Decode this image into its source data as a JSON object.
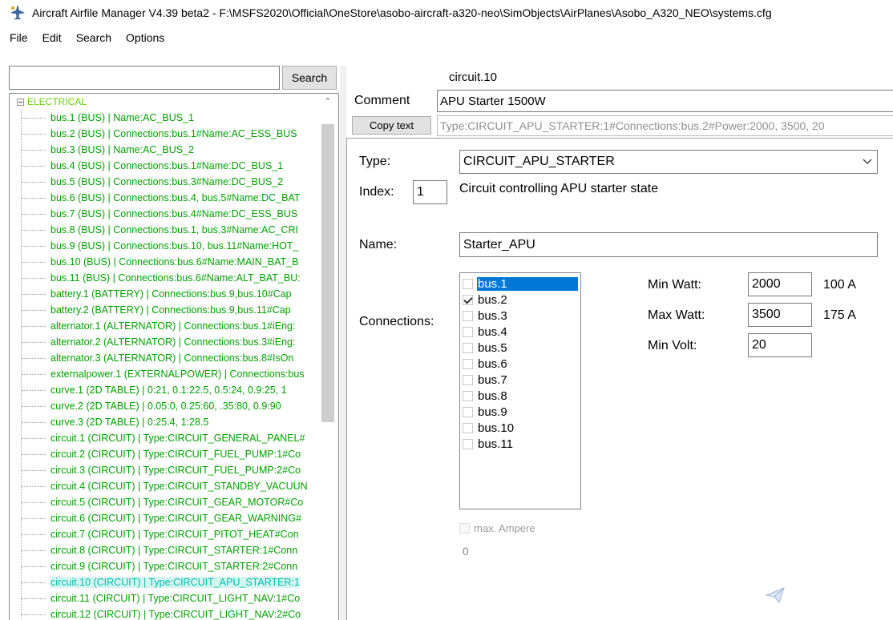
{
  "window": {
    "title": "Aircraft Airfile Manager V4.39 beta2 - F:\\MSFS2020\\Official\\OneStore\\asobo-aircraft-a320-neo\\SimObjects\\AirPlanes\\Asobo_A320_NEO\\systems.cfg",
    "app_icon": "aircraft-icon"
  },
  "menu": [
    "File",
    "Edit",
    "Search",
    "Options"
  ],
  "search": {
    "value": "",
    "button_label": "Search"
  },
  "tree": {
    "root_label": "ELECTRICAL",
    "items": [
      "bus.1 (BUS)  | Name:AC_BUS_1",
      "bus.2 (BUS)  | Connections:bus.1#Name:AC_ESS_BUS",
      "bus.3 (BUS)  | Name:AC_BUS_2",
      "bus.4 (BUS)  | Connections:bus.1#Name:DC_BUS_1",
      "bus.5 (BUS)  | Connections:bus.3#Name:DC_BUS_2",
      "bus.6 (BUS)  | Connections:bus.4, bus.5#Name:DC_BAT",
      "bus.7 (BUS)  | Connections:bus.4#Name:DC_ESS_BUS",
      "bus.8 (BUS)  | Connections:bus.1, bus.3#Name:AC_CRI",
      "bus.9 (BUS)  | Connections:bus.10, bus.11#Name:HOT_",
      "bus.10 (BUS)  | Connections:bus.6#Name:MAIN_BAT_B",
      "bus.11 (BUS)  | Connections:bus.6#Name:ALT_BAT_BU:",
      "battery.1 (BATTERY)  | Connections:bus.9,bus.10#Cap",
      "battery.2 (BATTERY)  | Connections:bus.9,bus.11#Cap",
      "alternator.1 (ALTERNATOR)  | Connections:bus.1#iEng:",
      "alternator.2 (ALTERNATOR)  | Connections:bus.3#iEng:",
      "alternator.3 (ALTERNATOR)  | Connections:bus.8#IsOn",
      "externalpower.1 (EXTERNALPOWER)  | Connections:bus",
      "curve.1 (2D TABLE)  | 0:21, 0.1:22.5, 0.5:24, 0.9:25, 1",
      "curve.2 (2D TABLE)  | 0.05:0, 0.25:60, .35:80, 0.9:90",
      "curve.3 (2D TABLE)  | 0:25.4, 1:28.5",
      "circuit.1 (CIRCUIT)  | Type:CIRCUIT_GENERAL_PANEL#",
      "circuit.2 (CIRCUIT)  | Type:CIRCUIT_FUEL_PUMP:1#Co",
      "circuit.3 (CIRCUIT)  | Type:CIRCUIT_FUEL_PUMP:2#Co",
      "circuit.4 (CIRCUIT)  | Type:CIRCUIT_STANDBY_VACUUN",
      "circuit.5 (CIRCUIT)  | Type:CIRCUIT_GEAR_MOTOR#Co",
      "circuit.6 (CIRCUIT)  | Type:CIRCUIT_GEAR_WARNING#",
      "circuit.7 (CIRCUIT)  | Type:CIRCUIT_PITOT_HEAT#Con",
      "circuit.8 (CIRCUIT)  | Type:CIRCUIT_STARTER:1#Conn",
      "circuit.9 (CIRCUIT)  | Type:CIRCUIT_STARTER:2#Conn",
      "circuit.10 (CIRCUIT)  | Type:CIRCUIT_APU_STARTER:1",
      "circuit.11 (CIRCUIT)  | Type:CIRCUIT_LIGHT_NAV:1#Co",
      "circuit.12 (CIRCUIT)  | Type:CIRCUIT_LIGHT_NAV:2#Co"
    ],
    "selected_index": 29
  },
  "editor": {
    "circuit_id": "circuit.10",
    "comment_label": "Comment",
    "comment_value": "APU Starter 1500W",
    "copy_button_label": "Copy text",
    "type_string": "Type:CIRCUIT_APU_STARTER:1#Connections:bus.2#Power:2000, 3500, 20",
    "type_label": "Type:",
    "type_value": "CIRCUIT_APU_STARTER",
    "index_label": "Index:",
    "index_value": "1",
    "index_description": "Circuit controlling APU starter state",
    "name_label": "Name:",
    "name_value": "Starter_APU",
    "connections_label": "Connections:",
    "connections": [
      {
        "label": "bus.1",
        "checked": false,
        "selected": true
      },
      {
        "label": "bus.2",
        "checked": true,
        "selected": false
      },
      {
        "label": "bus.3",
        "checked": false,
        "selected": false
      },
      {
        "label": "bus.4",
        "checked": false,
        "selected": false
      },
      {
        "label": "bus.5",
        "checked": false,
        "selected": false
      },
      {
        "label": "bus.6",
        "checked": false,
        "selected": false
      },
      {
        "label": "bus.7",
        "checked": false,
        "selected": false
      },
      {
        "label": "bus.8",
        "checked": false,
        "selected": false
      },
      {
        "label": "bus.9",
        "checked": false,
        "selected": false
      },
      {
        "label": "bus.10",
        "checked": false,
        "selected": false
      },
      {
        "label": "bus.11",
        "checked": false,
        "selected": false
      }
    ],
    "min_watt_label": "Min Watt:",
    "min_watt_value": "2000",
    "min_watt_amp": "100 A",
    "max_watt_label": "Max Watt:",
    "max_watt_value": "3500",
    "max_watt_amp": "175 A",
    "min_volt_label": "Min Volt:",
    "min_volt_value": "20",
    "max_ampere_label": "max. Ampere",
    "max_ampere_value": "0"
  },
  "colors": {
    "tree_text": "#00a000",
    "tree_root": "#66d100",
    "tree_selected_bg": "#d4f4f0",
    "list_selected_bg": "#0078d7"
  }
}
